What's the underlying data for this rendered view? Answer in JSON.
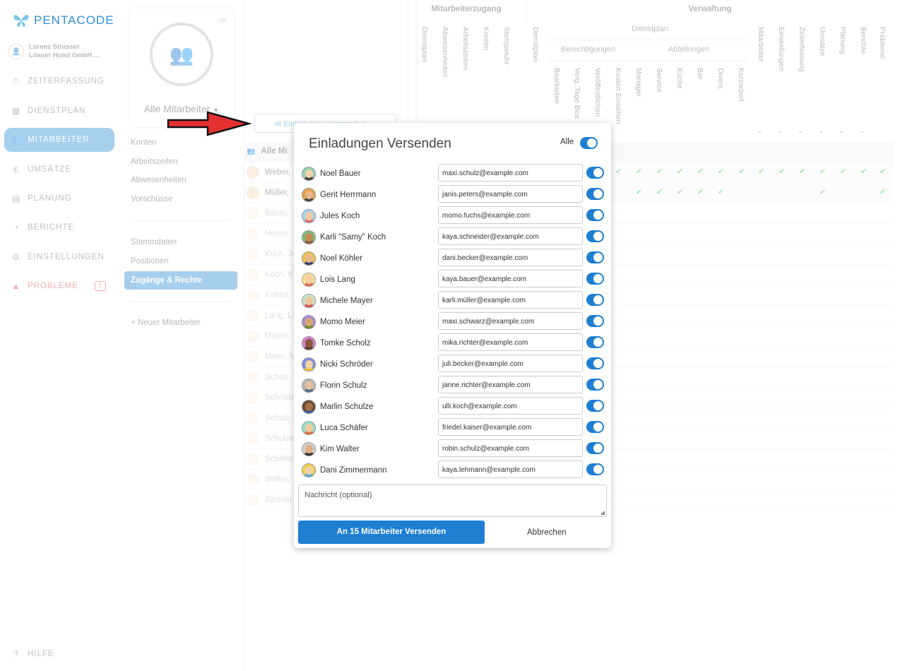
{
  "app": {
    "brand": "PENTACODE"
  },
  "user": {
    "name": "Lorenz Strasser",
    "company": "Lilaner Hund GmbH ..."
  },
  "nav": {
    "items": [
      {
        "label": "ZEITERFASSUNG",
        "icon": "stopwatch-icon"
      },
      {
        "label": "DIENSTPLAN",
        "icon": "calendar-grid-icon"
      },
      {
        "label": "MITARBEITER",
        "icon": "users-icon"
      },
      {
        "label": "UMSÄTZE",
        "icon": "euro-icon"
      },
      {
        "label": "PLANUNG",
        "icon": "calendar-icon"
      },
      {
        "label": "BERICHTE",
        "icon": "pie-chart-icon"
      },
      {
        "label": "EINSTELLUNGEN",
        "icon": "gear-icon"
      },
      {
        "label": "PROBLEME",
        "icon": "warning-icon",
        "badge": "7"
      }
    ],
    "help": "HILFE"
  },
  "sub": {
    "title": "Alle Mitarbeiter",
    "items1": [
      "Konten",
      "Arbeitszeiten",
      "Abwesenheiten",
      "Vorschüsse"
    ],
    "items2": [
      "Stammdaten",
      "Positionen",
      "Zugänge & Rechte"
    ],
    "new": "Neuer Mitarbeiter"
  },
  "table": {
    "group1": "Mitarbeiterzugang",
    "group2": "Verwaltung",
    "subgroup_dienstplan": "Dienstplan",
    "subgroup_berechtigungen": "Berechtigungen",
    "subgroup_abteilungen": "Abteilungen",
    "g1_cols": [
      "Dienstplan",
      "Abwesenheiten",
      "Arbeitszeiten",
      "Konten",
      "Stempeluhr"
    ],
    "g2_col0": "Dienstplan",
    "berechtigungen_cols": [
      "Bearbeiten",
      "Verg. Tage Bea",
      "Veröffentlichen",
      "Kosten Einsehen"
    ],
    "abteilungen_cols": [
      "Manager",
      "Service",
      "Küche",
      "Bar",
      "Divers",
      "Kurzarbeit"
    ],
    "right_cols": [
      "Mitarbeiter",
      "Einstellungen",
      "Zeiterfassung",
      "Umsätze",
      "Planung",
      "Berichte",
      "Probleme"
    ],
    "all_row": "Alle Mi",
    "rows": [
      "Weber,",
      "Müller,",
      "Bauer,",
      "Herrm",
      "Koch, Ju",
      "Koch, K",
      "Köhler,",
      "Lang, L",
      "Mayer,",
      "Meier, M",
      "Scholz,",
      "Schröde",
      "Schulz,",
      "Schulze",
      "Schäfer",
      "Walter,",
      "Zimmer"
    ],
    "invite_button": "Einladungen Versenden"
  },
  "modal": {
    "title": "Einladungen Versenden",
    "all_label": "Alle",
    "all_on": true,
    "rows": [
      {
        "name": "Noel Bauer",
        "email": "maxi.schulz@example.com",
        "on": true,
        "avatar": {
          "bg": "#8fd3b8",
          "skin": "#f3cfa6",
          "shirt": "#3a3a3a"
        }
      },
      {
        "name": "Gerit Herrmann",
        "email": "janis.peters@example.com",
        "on": true,
        "avatar": {
          "bg": "#e9a04c",
          "skin": "#e9b78a",
          "shirt": "#444444"
        }
      },
      {
        "name": "Jules Koch",
        "email": "momo.fuchs@example.com",
        "on": true,
        "avatar": {
          "bg": "#9fd5f0",
          "skin": "#f4c9a2",
          "shirt": "#e36b6b"
        }
      },
      {
        "name": "Karli \"Samy\" Koch",
        "email": "kaya.schneider@example.com",
        "on": true,
        "avatar": {
          "bg": "#7cbf7c",
          "skin": "#c98a5a",
          "shirt": "#8a5a3a"
        }
      },
      {
        "name": "Noel Köhler",
        "email": "dani.becker@example.com",
        "on": true,
        "avatar": {
          "bg": "#f4c04d",
          "skin": "#e8b990",
          "shirt": "#2d3e6b"
        }
      },
      {
        "name": "Lois Lang",
        "email": "kaya.bauer@example.com",
        "on": true,
        "avatar": {
          "bg": "#f6e08a",
          "skin": "#f2cda8",
          "shirt": "#e26b4b"
        }
      },
      {
        "name": "Michele Mayer",
        "email": "karli.müller@example.com",
        "on": true,
        "avatar": {
          "bg": "#c9e6c9",
          "skin": "#f0c59b",
          "shirt": "#d9534f"
        }
      },
      {
        "name": "Momo Meier",
        "email": "maxi.schwarz@example.com",
        "on": true,
        "avatar": {
          "bg": "#a98ad8",
          "skin": "#d9a56f",
          "shirt": "#6b8e23"
        }
      },
      {
        "name": "Tomke Scholz",
        "email": "mika.richter@example.com",
        "on": true,
        "avatar": {
          "bg": "#d77ad0",
          "skin": "#8a5a3a",
          "shirt": "#5a3a2a"
        }
      },
      {
        "name": "Nicki Schröder",
        "email": "juli.becker@example.com",
        "on": true,
        "avatar": {
          "bg": "#7a8fe0",
          "skin": "#f3d2a8",
          "shirt": "#f0c030"
        }
      },
      {
        "name": "Florin Schulz",
        "email": "janne.richter@example.com",
        "on": true,
        "avatar": {
          "bg": "#b8b8b8",
          "skin": "#e8c09a",
          "shirt": "#4a6a8a"
        }
      },
      {
        "name": "Marlin Schulze",
        "email": "ulli.koch@example.com",
        "on": true,
        "avatar": {
          "bg": "#6b4a2f",
          "skin": "#a8704a",
          "shirt": "#3a5a9a"
        }
      },
      {
        "name": "Luca Schäfer",
        "email": "friedel.kaiser@example.com",
        "on": true,
        "avatar": {
          "bg": "#8fe0c9",
          "skin": "#f2c8a0",
          "shirt": "#e0703a"
        }
      },
      {
        "name": "Kim Walter",
        "email": "robin.schulz@example.com",
        "on": true,
        "avatar": {
          "bg": "#d0d0d0",
          "skin": "#e0b088",
          "shirt": "#333333"
        }
      },
      {
        "name": "Dani Zimmermann",
        "email": "kaya.lehmann@example.com",
        "on": true,
        "avatar": {
          "bg": "#f3d24d",
          "skin": "#f2d2aa",
          "shirt": "#5ab0d8"
        }
      }
    ],
    "message_placeholder": "Nachricht (optional)",
    "send_label": "An 15 Mitarbeiter Versenden",
    "cancel_label": "Abbrechen"
  },
  "colors": {
    "accent": "#1e7fd2",
    "brand": "#2c8fd6",
    "check": "#2db84a",
    "warning": "#e03a3a"
  }
}
